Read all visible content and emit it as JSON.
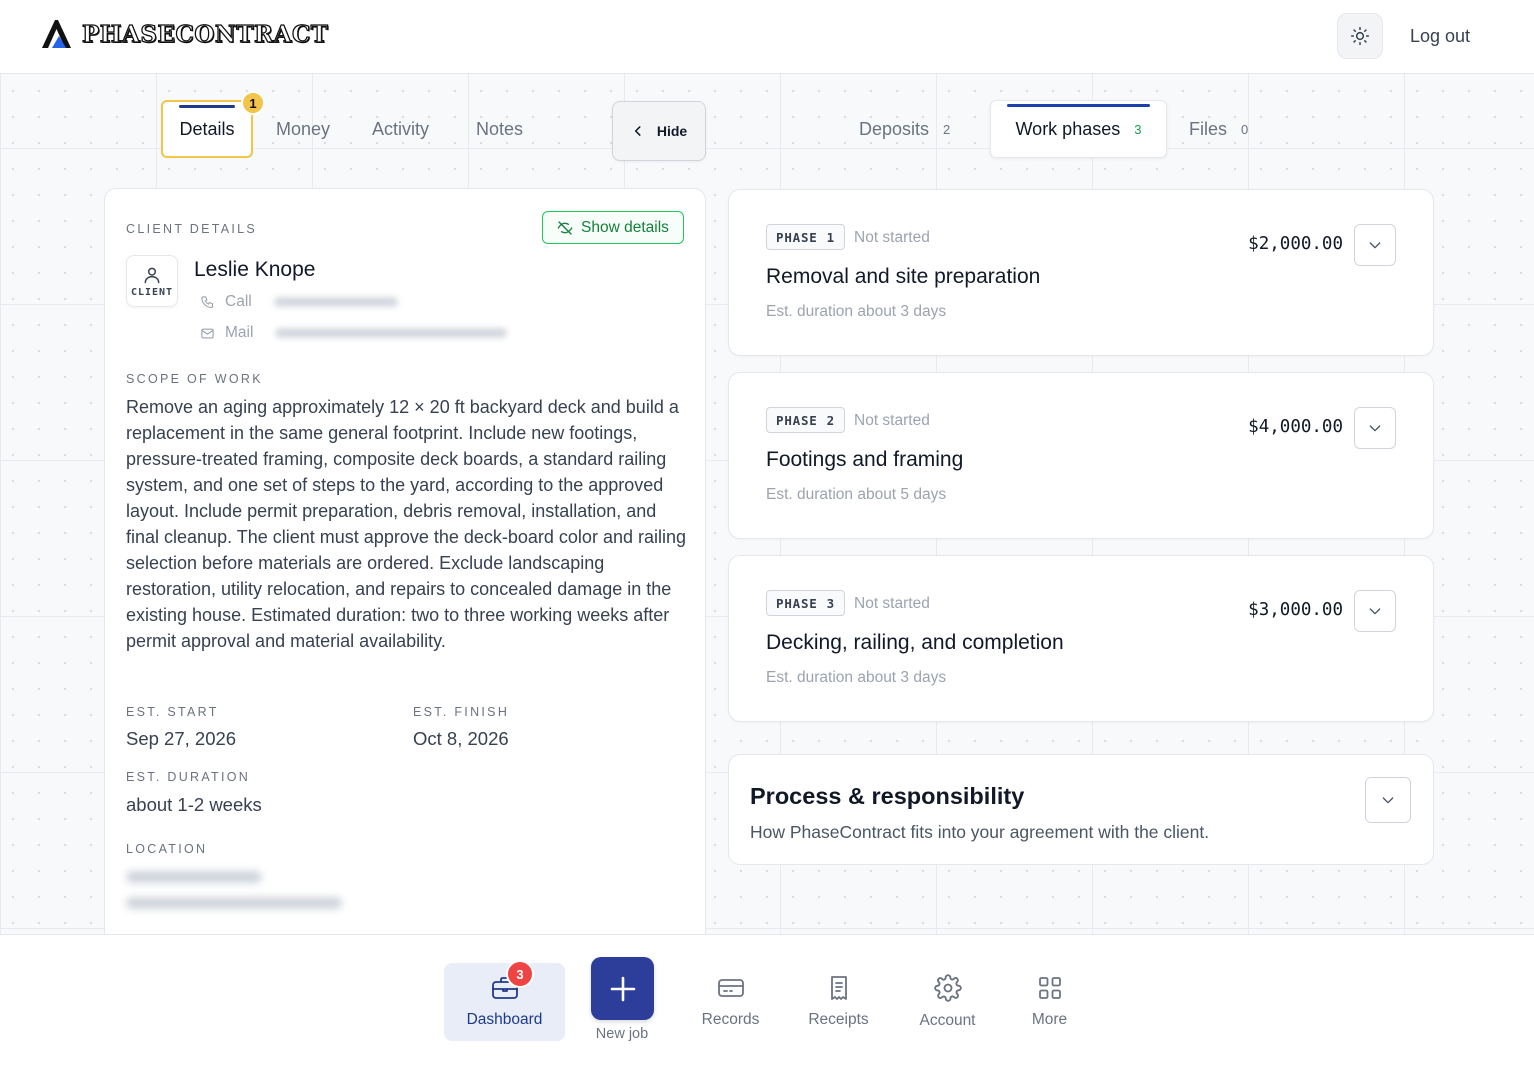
{
  "header": {
    "logo_text": "PHASECONTRACT",
    "logout_label": "Log out"
  },
  "left_tabs": {
    "details": "Details",
    "details_badge": "1",
    "money": "Money",
    "activity": "Activity",
    "notes": "Notes"
  },
  "hide_label": "Hide",
  "right_tabs": {
    "deposits": "Deposits",
    "deposits_count": "2",
    "work_phases": "Work phases",
    "work_phases_count": "3",
    "files": "Files",
    "files_count": "0"
  },
  "client": {
    "section_label": "CLIENT DETAILS",
    "show_details_label": "Show details",
    "avatar_label": "CLIENT",
    "name": "Leslie Knope",
    "call_label": "Call",
    "mail_label": "Mail"
  },
  "scope": {
    "label": "SCOPE OF WORK",
    "text": "Remove an aging approximately 12 × 20 ft backyard deck and build a replacement in the same general footprint. Include new footings, pressure-treated framing, composite deck boards, a standard railing system, and one set of steps to the yard, according to the approved layout. Include permit preparation, debris removal, installation, and final cleanup. The client must approve the deck-board color and railing selection before materials are ordered. Exclude landscaping restoration, utility relocation, and repairs to concealed damage in the existing house. Estimated duration: two to three working weeks after permit approval and material availability."
  },
  "schedule": {
    "start_label": "EST. START",
    "start_value": "Sep 27, 2026",
    "finish_label": "EST. FINISH",
    "finish_value": "Oct 8, 2026",
    "duration_label": "EST. DURATION",
    "duration_value": "about 1-2 weeks",
    "location_label": "LOCATION"
  },
  "phases": [
    {
      "tag": "PHASE",
      "num": "1",
      "status": "Not started",
      "title": "Removal and site preparation",
      "duration": "Est. duration about 3 days",
      "price": "$2,000.00"
    },
    {
      "tag": "PHASE",
      "num": "2",
      "status": "Not started",
      "title": "Footings and framing",
      "duration": "Est. duration about 5 days",
      "price": "$4,000.00"
    },
    {
      "tag": "PHASE",
      "num": "3",
      "status": "Not started",
      "title": "Decking, railing, and completion",
      "duration": "Est. duration about 3 days",
      "price": "$3,000.00"
    }
  ],
  "process": {
    "title": "Process & responsibility",
    "subtitle": "How PhaseContract fits into your agreement with the client."
  },
  "bottom_nav": {
    "dashboard": "Dashboard",
    "dashboard_badge": "3",
    "new_job": "New job",
    "records": "Records",
    "receipts": "Receipts",
    "account": "Account",
    "more": "More"
  },
  "colors": {
    "brand_navy": "#1e3a8a",
    "accent_yellow": "#f3c44a",
    "success_green": "#16a34a",
    "danger_red": "#ef4444",
    "new_job_blue": "#2c3e9a"
  }
}
